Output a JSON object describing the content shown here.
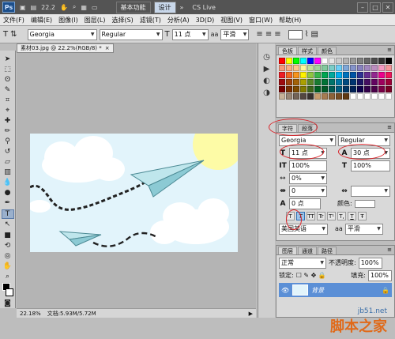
{
  "app": {
    "logo": "Ps",
    "zoom_dropdown": "22.2",
    "essentials": "基本功能",
    "design": "设计",
    "more": "»",
    "cslive": "CS Live"
  },
  "menus": [
    "文件(F)",
    "编辑(E)",
    "图像(I)",
    "图层(L)",
    "选择(S)",
    "滤镜(T)",
    "分析(A)",
    "3D(D)",
    "视图(V)",
    "窗口(W)",
    "帮助(H)"
  ],
  "options": {
    "font_family": "Georgia",
    "font_style": "Regular",
    "font_size": "11 点",
    "antialias": "平滑"
  },
  "document": {
    "tab_title": "素材03.jpg @ 22.2%(RGB/8) *",
    "zoom": "22.18%",
    "doc_size": "文档:5.93M/5.72M"
  },
  "swatches_panel": {
    "tabs": [
      "色板",
      "样式",
      "颜色"
    ],
    "colors": [
      "#ff0000",
      "#ffff00",
      "#00ff00",
      "#00ffff",
      "#0000ff",
      "#ff00ff",
      "#ffffff",
      "#e6e6e6",
      "#cccccc",
      "#b3b3b3",
      "#999999",
      "#808080",
      "#666666",
      "#4d4d4d",
      "#333333",
      "#000000",
      "#f7977a",
      "#f9ad81",
      "#fdc68a",
      "#fff79a",
      "#c4df9b",
      "#a3d39c",
      "#82ca9d",
      "#7bcdc8",
      "#6ecff6",
      "#7ea7d8",
      "#8493ca",
      "#8882be",
      "#a187be",
      "#bc8dbf",
      "#f49ac2",
      "#f6989d",
      "#ed1c24",
      "#f26522",
      "#f7941d",
      "#fff200",
      "#8dc63f",
      "#39b54a",
      "#00a651",
      "#00a99d",
      "#00aeef",
      "#0072bc",
      "#0054a6",
      "#2e3192",
      "#662d91",
      "#92278f",
      "#ec008c",
      "#ed145b",
      "#9e0b0f",
      "#a0410d",
      "#a36209",
      "#aba000",
      "#598527",
      "#197b30",
      "#007236",
      "#00746b",
      "#0076a3",
      "#004b80",
      "#003471",
      "#1b1464",
      "#440e62",
      "#630460",
      "#9e005d",
      "#9e0039",
      "#790000",
      "#7b2e00",
      "#7d4900",
      "#827b00",
      "#406618",
      "#005e20",
      "#005826",
      "#005952",
      "#005b7f",
      "#003663",
      "#002157",
      "#0d004c",
      "#32004b",
      "#4b0049",
      "#7b0046",
      "#7a0026",
      "#c7b299",
      "#998675",
      "#736357",
      "#534741",
      "#37302d",
      "#c69c6d",
      "#a67c52",
      "#8c6239",
      "#754c24",
      "#603913",
      "#ffffff",
      "#ffffff",
      "#ffffff",
      "#ffffff",
      "#ffffff",
      "#ffffff"
    ]
  },
  "char_panel": {
    "tabs": [
      "字符",
      "段落"
    ],
    "font_family": "Georgia",
    "font_style": "Regular",
    "size_icon": "T",
    "size": "11 点",
    "leading": "30 点",
    "vscale": "100%",
    "hscale": "100%",
    "tracking": "0%",
    "kerning": "0",
    "baseline": "0 点",
    "color_label": "颜色:",
    "style_buttons": [
      "T",
      "T",
      "TT",
      "Tr",
      "T¹",
      "T,",
      "T",
      "Ŧ"
    ],
    "language": "美国英语",
    "aa_icon": "aa",
    "antialias": "平滑"
  },
  "layers_panel": {
    "tabs": [
      "图层",
      "通道",
      "路径"
    ],
    "blend_mode": "正常",
    "opacity_label": "不透明度:",
    "opacity": "100%",
    "lock_label": "锁定:",
    "fill_label": "填充:",
    "fill": "100%",
    "layer_name": "背景"
  },
  "watermark": {
    "site": "jb51.net",
    "brand": "脚本之家"
  }
}
